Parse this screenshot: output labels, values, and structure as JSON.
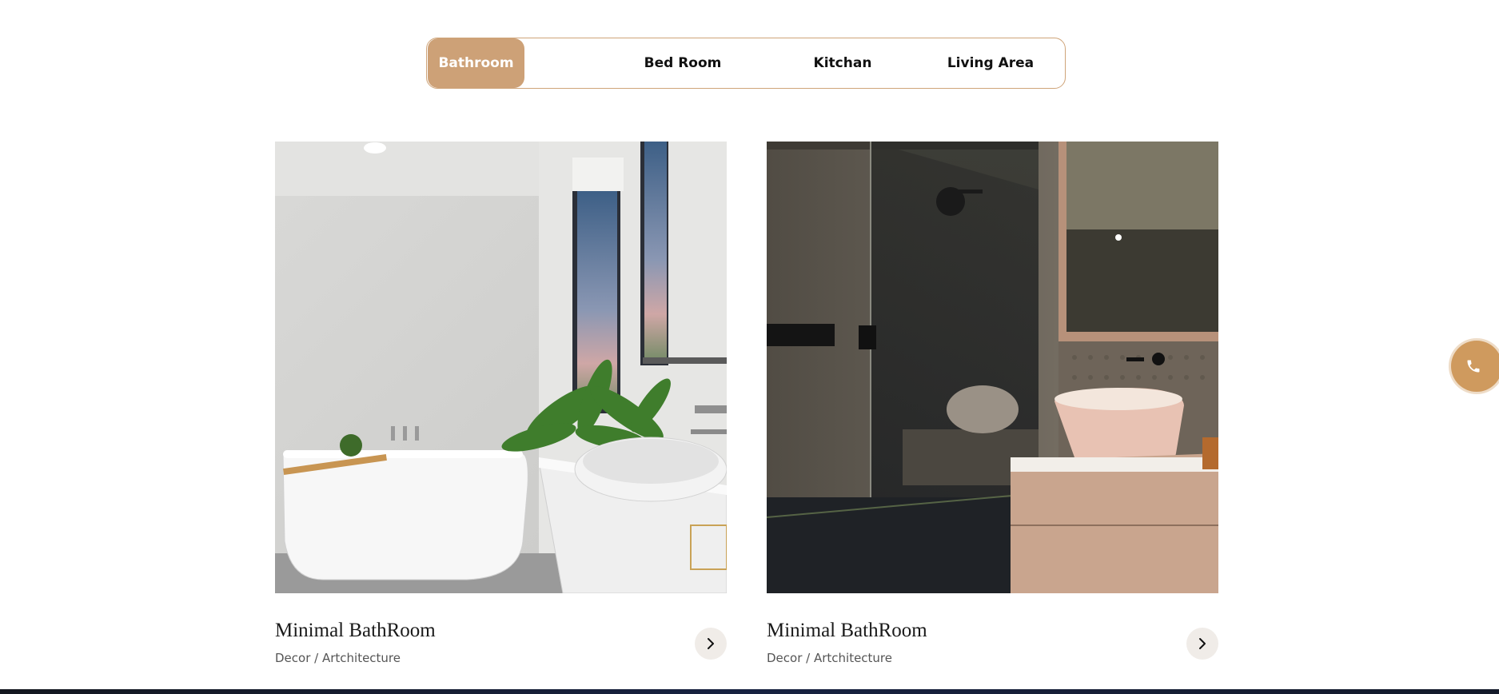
{
  "tabs": [
    {
      "label": "Bathroom",
      "active": true
    },
    {
      "label": "Bed Room",
      "active": false
    },
    {
      "label": "Kitchan",
      "active": false
    },
    {
      "label": "Living Area",
      "active": false
    }
  ],
  "cards": [
    {
      "title": "Minimal BathRoom",
      "subtitle": "Decor / Artchitecture",
      "image": "bathroom-bathtub-photo"
    },
    {
      "title": "Minimal BathRoom",
      "subtitle": "Decor / Artchitecture",
      "image": "bathroom-shower-photo"
    }
  ],
  "icons": {
    "card_arrow": "chevron-right-icon",
    "floating": "phone-icon"
  },
  "colors": {
    "accent": "#cda177",
    "tab_border": "#cfa479",
    "phone_button": "#cf9a5e",
    "arrow_button_bg": "#f0ece8"
  }
}
